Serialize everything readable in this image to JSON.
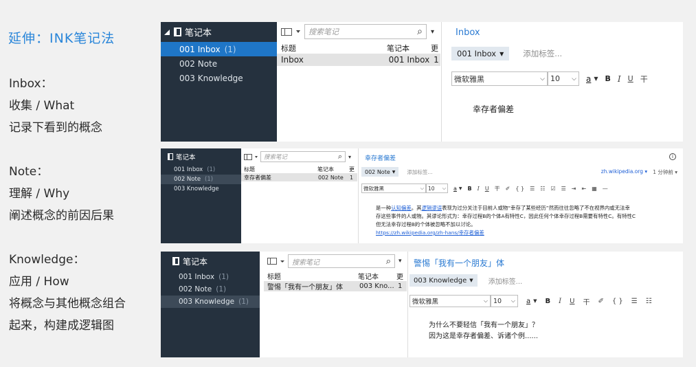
{
  "title": "延伸：INK笔记法",
  "blocks": [
    {
      "name": "Inbox：",
      "line1": "收集 / What",
      "line2": "记录下看到的概念",
      "line3": ""
    },
    {
      "name": "Note：",
      "line1": "理解 / Why",
      "line2": "阐述概念的前因后果",
      "line3": ""
    },
    {
      "name": "Knowledge：",
      "line1": "应用 / How",
      "line2": "将概念与其他概念组合",
      "line3": "起来，构建成逻辑图"
    }
  ],
  "notebook_label": "笔记本",
  "notebooks": [
    {
      "label": "001 Inbox",
      "count": "(1)"
    },
    {
      "label": "002 Note",
      "count": "(1)"
    },
    {
      "label": "003 Knowledge",
      "count": "(1)"
    }
  ],
  "search_placeholder": "搜索笔记",
  "columns": {
    "title": "标题",
    "notebook": "笔记本",
    "updated": "更"
  },
  "add_tag": "添加标签...",
  "font_name": "微软雅黑",
  "font_size": "10",
  "toolbar": {
    "a": "a",
    "bold": "B",
    "italic": "I",
    "underline": "U",
    "strike": "干",
    "brush": "✐",
    "code": "{ }",
    "list_bullet": "☰",
    "list_num": "☷",
    "check": "☑",
    "align": "☰",
    "indent": "⇥",
    "outdent": "⇤",
    "table": "▦",
    "hr": "—"
  },
  "shot1": {
    "row": {
      "title": "Inbox",
      "notebook": "001 Inbox",
      "updated": "1"
    },
    "note_title": "Inbox",
    "tag": "001 Inbox",
    "body": "幸存者偏差"
  },
  "shot2": {
    "row": {
      "title": "幸存者偏差",
      "notebook": "002 Note",
      "updated": "1"
    },
    "note_title": "幸存者偏差",
    "tag": "002 Note",
    "source": "zh.wikipedia.org",
    "source_time": "1 分钟前",
    "body_pre": "是一种",
    "body_link1": "认知偏差",
    "body_mid": "。其",
    "body_link2": "逻辑谬误",
    "body_rest1": "表现为过分关注于目前人或物“幸存了某些经历”然而往往忽略了不在视界内或无法幸",
    "body_rest2": "存这些事件的人或物。其谬论形式为：幸存过程B的个体A有特性C，因此任何个体幸存过程B需要有特性C。有特性C",
    "body_rest3": "但无法幸存过程B的个体被忽略不加以讨论。",
    "body_url": "https://zh.wikipedia.org/zh-hans/幸存者偏差"
  },
  "shot3": {
    "row": {
      "title": "警惕「我有一个朋友」体",
      "notebook": "003 Kno...",
      "updated": "1"
    },
    "note_title": "警惕「我有一个朋友」体",
    "tag": "003 Knowledge",
    "body1": "为什么不要轻信「我有一个朋友」？",
    "body2": "因为这是幸存者偏差、诉诸个例......"
  },
  "colors": {
    "accent": "#2a86d9",
    "sidebar": "#25313e",
    "selected": "#1f76c7",
    "selected_muted": "#3d4a58"
  }
}
